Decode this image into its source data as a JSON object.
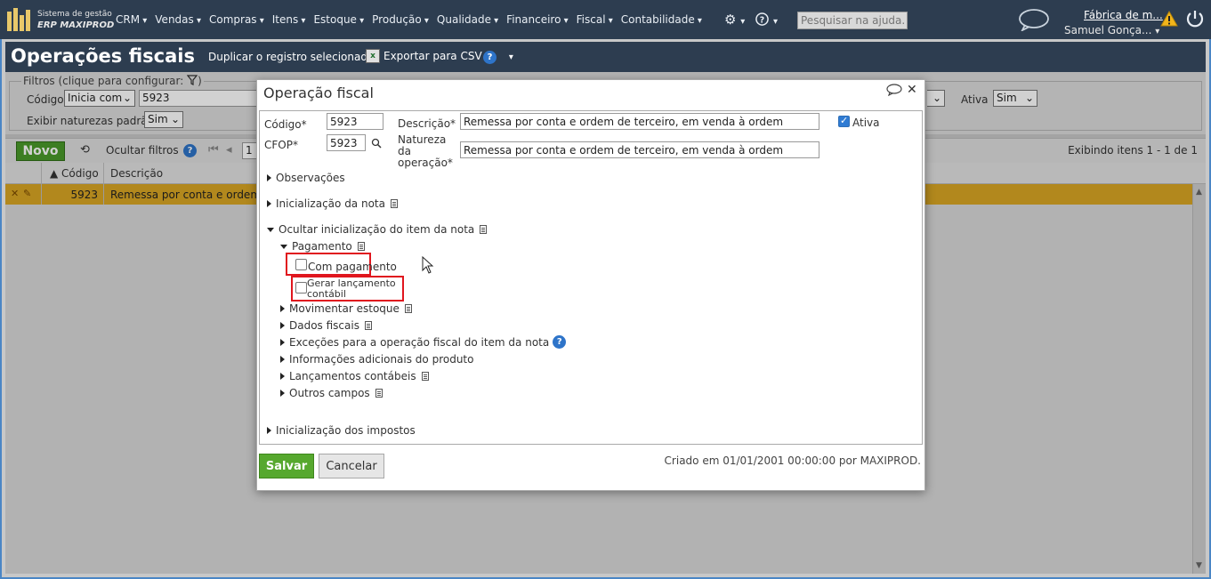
{
  "topbar": {
    "brand_line1": "Sistema de gestão",
    "brand_line2": "ERP MAXIPROD",
    "menu": [
      "CRM",
      "Vendas",
      "Compras",
      "Itens",
      "Estoque",
      "Produção",
      "Qualidade",
      "Financeiro",
      "Fiscal",
      "Contabilidade"
    ],
    "help_search_placeholder": "Pesquisar na ajuda...",
    "company": "Fábrica de m...",
    "user": "Samuel Gonça..."
  },
  "page": {
    "title": "Operações fiscais",
    "duplicate": "Duplicar o registro selecionado",
    "export_csv": "Exportar para CSV"
  },
  "filters": {
    "legend": "Filtros (clique para configurar:",
    "legend_end": ")",
    "codigo_label": "Código",
    "codigo_op": "Inicia com",
    "codigo_value": "5923",
    "exibir_label": "Exibir naturezas padrão",
    "exibir_value": "Sim",
    "ativa_label": "Ativa",
    "ativa_value": "Sim"
  },
  "toolbar": {
    "novo": "Novo",
    "ocultar": "Ocultar filtros",
    "page_num": "1",
    "exibindo": "Exibindo itens 1 - 1 de 1"
  },
  "grid": {
    "columns": [
      "Código",
      "Descrição"
    ],
    "rows": [
      {
        "codigo": "5923",
        "descricao": "Remessa por conta e ordem d"
      }
    ]
  },
  "modal": {
    "title": "Operação fiscal",
    "codigo_label": "Código*",
    "codigo_value": "5923",
    "cfop_label": "CFOP*",
    "cfop_value": "5923",
    "descricao_label": "Descrição*",
    "descricao_value": "Remessa por conta e ordem de terceiro, em venda à ordem",
    "natureza_label_1": "Natureza",
    "natureza_label_2": "da",
    "natureza_label_3": "operação*",
    "natureza_value": "Remessa por conta e ordem de terceiro, em venda à ordem",
    "ativa_label": "Ativa",
    "ativa_checked": true,
    "sections": {
      "observacoes": "Observações",
      "inicializacao_nota": "Inicialização da nota",
      "ocultar_inicializacao_item": "Ocultar inicialização do item da nota",
      "pagamento": "Pagamento",
      "com_pagamento": "Com pagamento",
      "gerar_lancamento_1": "Gerar lançamento",
      "gerar_lancamento_2": "contábil",
      "movimentar_estoque": "Movimentar estoque",
      "dados_fiscais": "Dados fiscais",
      "excecoes": "Exceções para a operação fiscal do item da nota",
      "informacoes_adicionais": "Informações adicionais do produto",
      "lancamentos_contabeis": "Lançamentos contábeis",
      "outros_campos": "Outros campos",
      "inicializacao_impostos": "Inicialização dos impostos"
    },
    "salvar": "Salvar",
    "cancelar": "Cancelar",
    "criado": "Criado em 01/01/2001 00:00:00 por MAXIPROD."
  },
  "colors": {
    "navbar": "#2d3d50",
    "accent_green": "#56a82e",
    "selected_row": "#d9a624",
    "highlight_red": "#e0161e",
    "checkbox_blue": "#2f7bd3"
  },
  "icons": [
    "settings-gear-icon",
    "help-icon",
    "chat-bubble-icon",
    "warning-icon",
    "power-icon",
    "csv-icon",
    "filter-icon",
    "refresh-icon",
    "search-icon",
    "close-icon",
    "document-icon",
    "mouse-cursor-icon"
  ]
}
